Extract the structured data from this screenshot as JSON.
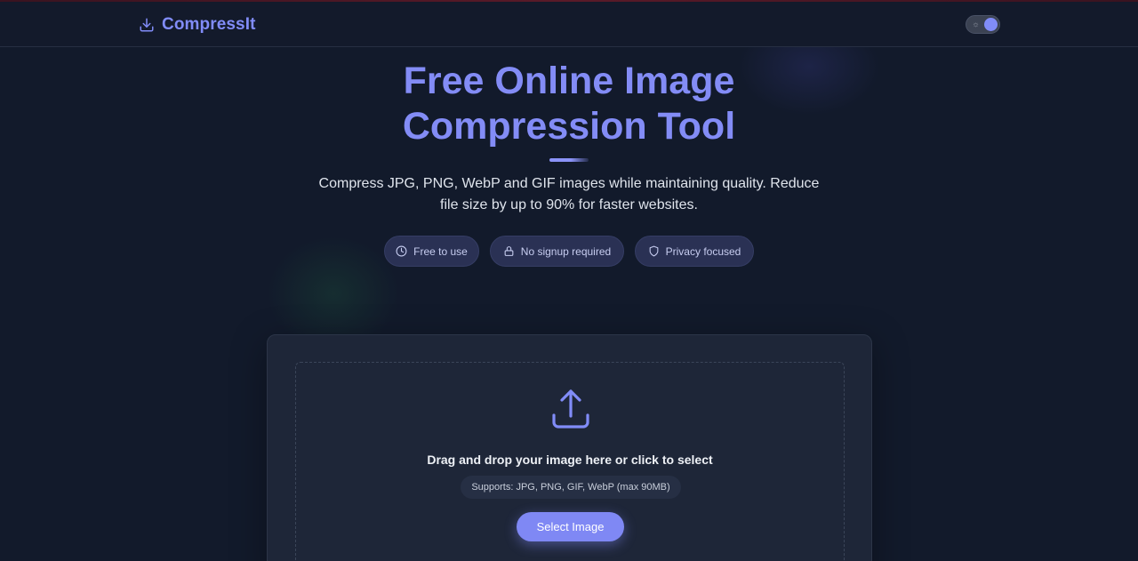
{
  "header": {
    "logo_text": "CompressIt",
    "logo_icon": "download-icon",
    "theme_toggle": {
      "icon": "sun-icon",
      "state": "dark"
    }
  },
  "hero": {
    "title_line1": "Free Online Image",
    "title_line2": "Compression Tool",
    "subtitle_line1": "Compress JPG, PNG, WebP and GIF images while maintaining quality. Reduce",
    "subtitle_line2": "file size by up to 90% for faster websites."
  },
  "badges": [
    {
      "label": "Free to use",
      "icon": "clock-icon"
    },
    {
      "label": "No signup required",
      "icon": "lock-icon"
    },
    {
      "label": "Privacy focused",
      "icon": "shield-icon"
    }
  ],
  "upload": {
    "icon": "upload-icon",
    "drop_text": "Drag and drop your image here or click to select",
    "supports_text": "Supports: JPG, PNG, GIF, WebP (max 90MB)",
    "button_label": "Select Image"
  },
  "colors": {
    "accent": "#818cf8",
    "background": "#121a2b",
    "card": "#1e2638",
    "badge": "#2a3154"
  }
}
